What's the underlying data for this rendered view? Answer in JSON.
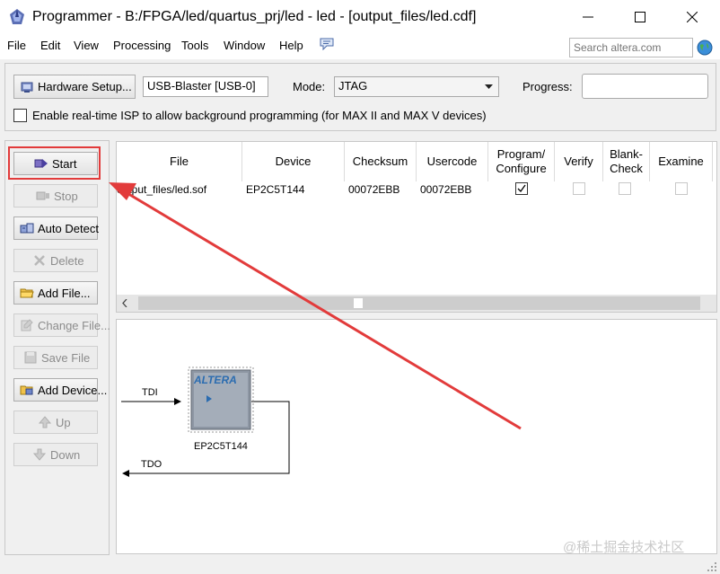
{
  "window": {
    "title": "Programmer - B:/FPGA/led/quartus_prj/led - led - [output_files/led.cdf]"
  },
  "menu": {
    "items": [
      "File",
      "Edit",
      "View",
      "Processing",
      "Tools",
      "Window",
      "Help"
    ],
    "search_placeholder": "Search altera.com"
  },
  "toolbar": {
    "hardware_setup_label": "Hardware Setup...",
    "hardware_value": "USB-Blaster [USB-0]",
    "mode_label": "Mode:",
    "mode_value": "JTAG",
    "progress_label": "Progress:",
    "isp_checkbox_label": "Enable real-time ISP to allow background programming (for MAX II and MAX V devices)",
    "isp_checked": false
  },
  "side_buttons": [
    {
      "label": "Start",
      "icon": "start-icon",
      "enabled": true,
      "highlighted": true
    },
    {
      "label": "Stop",
      "icon": "stop-icon",
      "enabled": false
    },
    {
      "label": "Auto Detect",
      "icon": "auto-detect-icon",
      "enabled": true
    },
    {
      "label": "Delete",
      "icon": "delete-icon",
      "enabled": false
    },
    {
      "label": "Add File...",
      "icon": "folder-icon",
      "enabled": true
    },
    {
      "label": "Change File...",
      "icon": "change-file-icon",
      "enabled": false
    },
    {
      "label": "Save File",
      "icon": "save-icon",
      "enabled": false
    },
    {
      "label": "Add Device...",
      "icon": "add-device-icon",
      "enabled": true
    },
    {
      "label": "Up",
      "icon": "up-icon",
      "enabled": false
    },
    {
      "label": "Down",
      "icon": "down-icon",
      "enabled": false
    }
  ],
  "table": {
    "columns": [
      "File",
      "Device",
      "Checksum",
      "Usercode",
      "Program/ Configure",
      "Verify",
      "Blank- Check",
      "Examine"
    ],
    "rows": [
      {
        "file": "output_files/led.sof",
        "device": "EP2C5T144",
        "checksum": "00072EBB",
        "usercode": "00072EBB",
        "program": true,
        "verify": false,
        "blank_check": false,
        "examine": false
      }
    ]
  },
  "chain": {
    "tdi_label": "TDI",
    "tdo_label": "TDO",
    "chip_brand": "ALTERA",
    "device_label": "EP2C5T144"
  },
  "watermark": "@稀土掘金技术社区",
  "colors": {
    "highlight_red": "#e23b3b",
    "chip_blue": "#2b6cb0"
  }
}
